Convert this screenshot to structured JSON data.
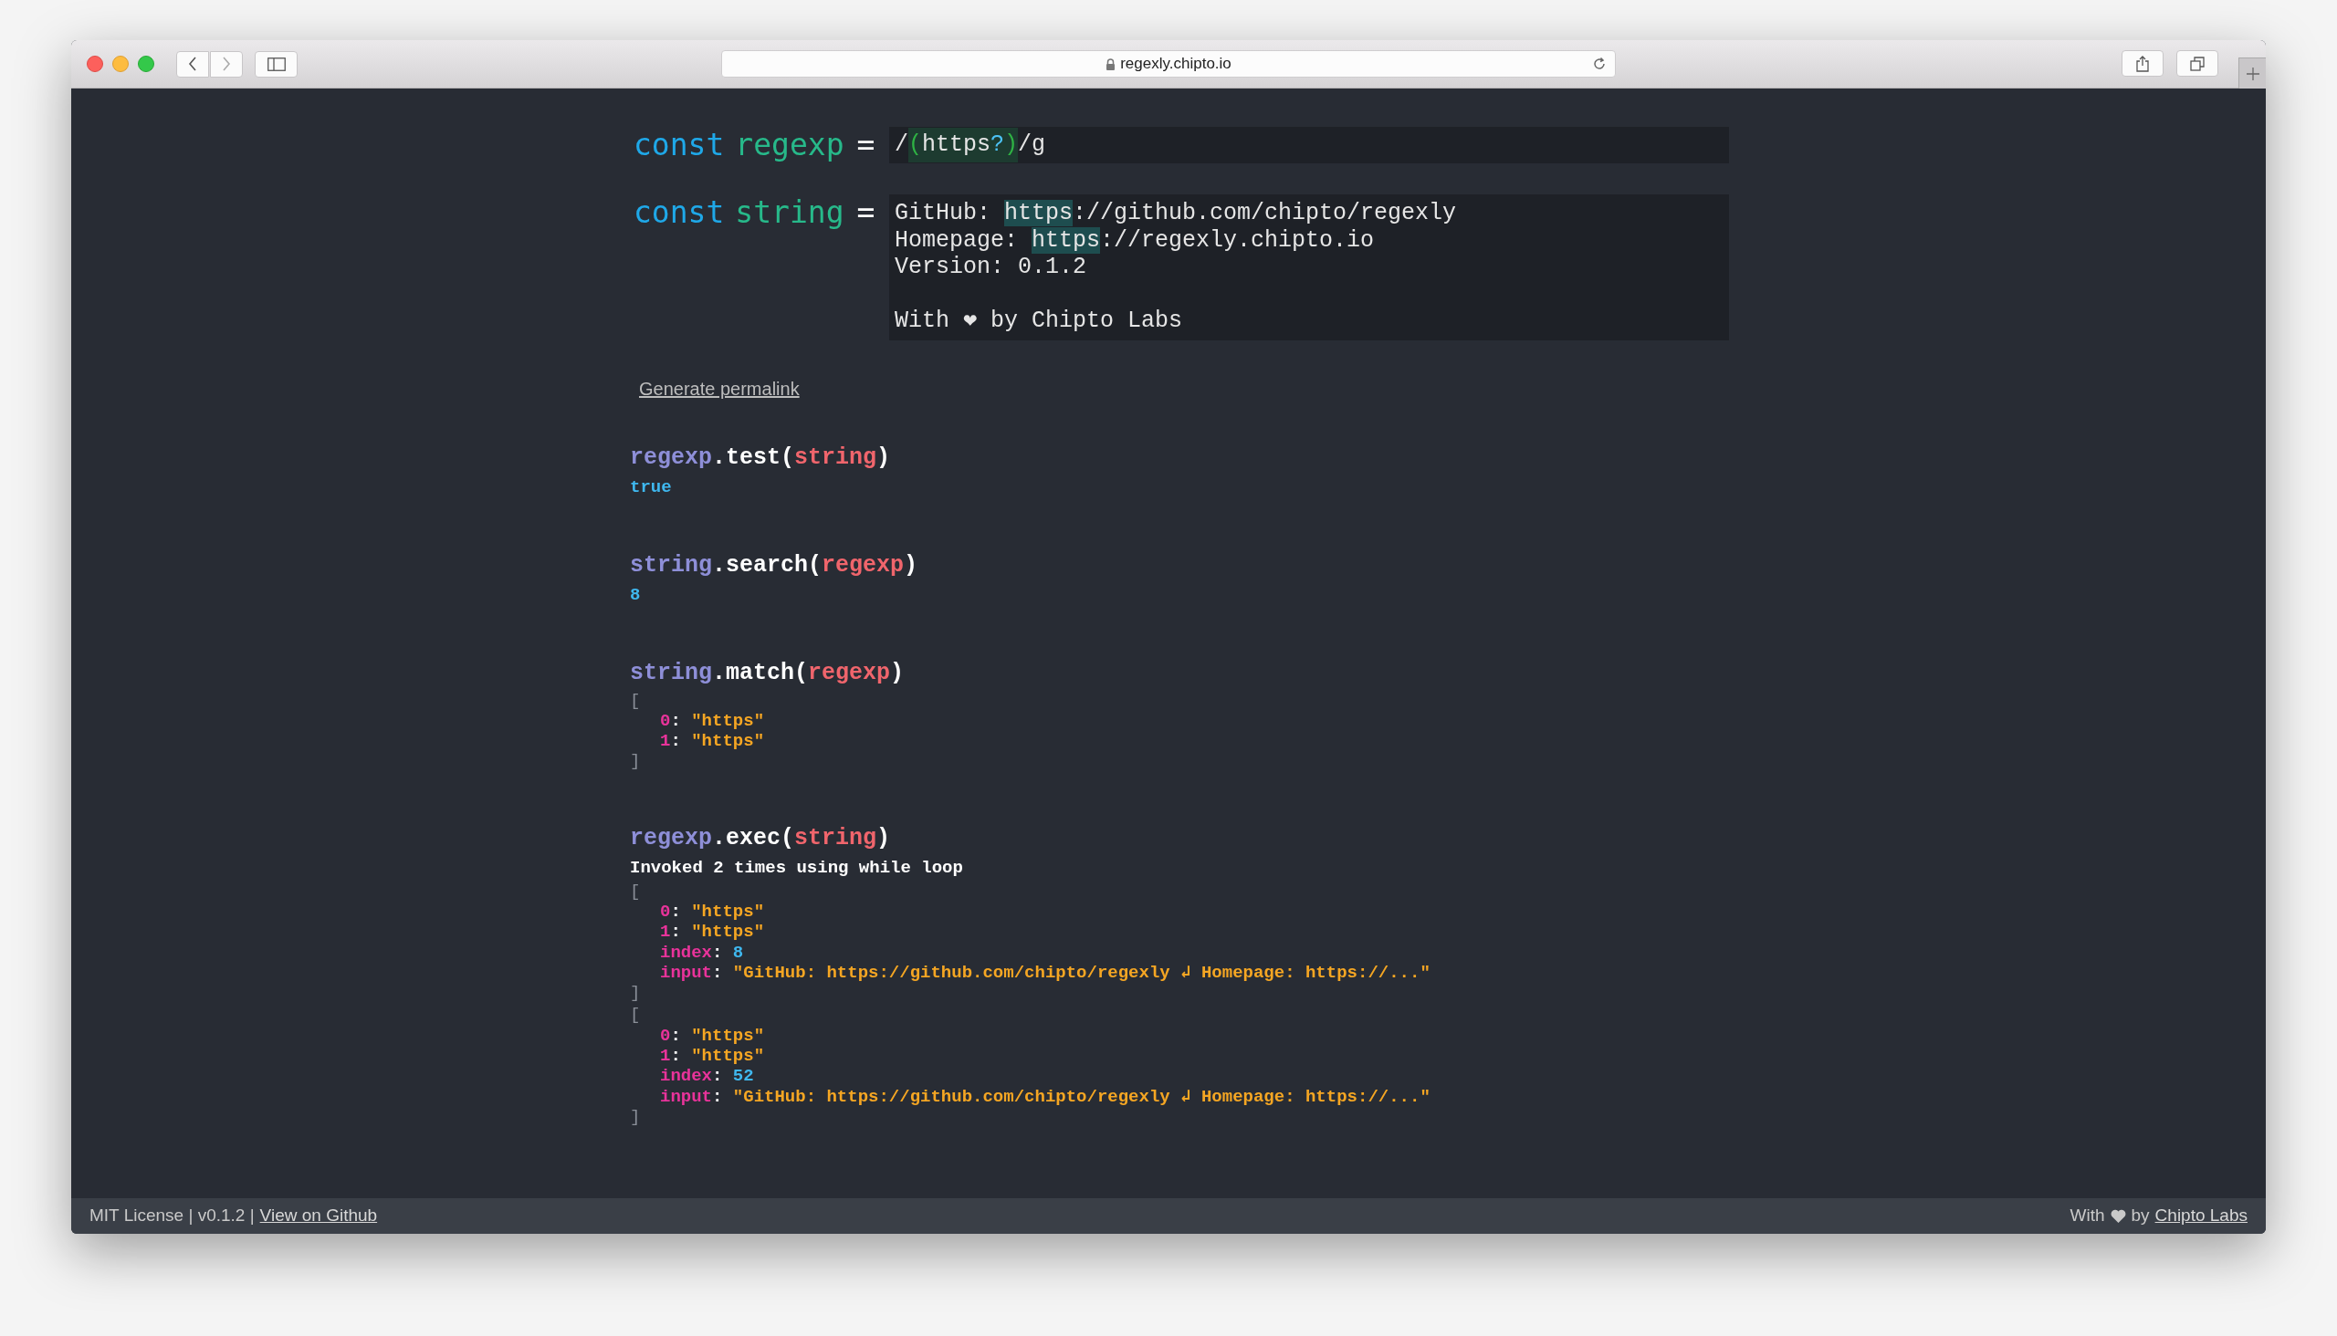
{
  "browser": {
    "url": "regexly.chipto.io"
  },
  "regexp": {
    "keyword": "const",
    "name": "regexp",
    "operator": "=",
    "pattern": [
      {
        "text": "/",
        "kind": "plain"
      },
      {
        "text": "(",
        "kind": "group"
      },
      {
        "text": "https",
        "kind": "literal"
      },
      {
        "text": "?",
        "kind": "quantifier"
      },
      {
        "text": ")",
        "kind": "group"
      },
      {
        "text": "/g",
        "kind": "plain"
      }
    ]
  },
  "string": {
    "keyword": "const",
    "name": "string",
    "operator": "=",
    "lines": [
      {
        "gap_before": false,
        "segments": [
          {
            "text": "GitHub: ",
            "highlighted": false
          },
          {
            "text": "https",
            "highlighted": true
          },
          {
            "text": "://github.com/chipto/regexly",
            "highlighted": false
          }
        ]
      },
      {
        "gap_before": false,
        "segments": [
          {
            "text": "Homepage: ",
            "highlighted": false
          },
          {
            "text": "https",
            "highlighted": true
          },
          {
            "text": "://regexly.chipto.io",
            "highlighted": false
          }
        ]
      },
      {
        "gap_before": false,
        "segments": [
          {
            "text": "Version: 0.1.2",
            "highlighted": false
          }
        ]
      },
      {
        "gap_before": true,
        "segments": [
          {
            "text": "With ❤ by Chipto Labs",
            "highlighted": false
          }
        ]
      }
    ]
  },
  "permalink": "Generate permalink",
  "results": [
    {
      "call": [
        {
          "text": "regexp",
          "kind": "receiver"
        },
        {
          "text": ".test(",
          "kind": "method"
        },
        {
          "text": "string",
          "kind": "argument"
        },
        {
          "text": ")",
          "kind": "method"
        }
      ],
      "output": [
        {
          "kind": "value",
          "text": "true"
        }
      ]
    },
    {
      "call": [
        {
          "text": "string",
          "kind": "receiver"
        },
        {
          "text": ".search(",
          "kind": "method"
        },
        {
          "text": "regexp",
          "kind": "argument"
        },
        {
          "text": ")",
          "kind": "method"
        }
      ],
      "output": [
        {
          "kind": "value",
          "text": "8"
        }
      ]
    },
    {
      "call": [
        {
          "text": "string",
          "kind": "receiver"
        },
        {
          "text": ".match(",
          "kind": "method"
        },
        {
          "text": "regexp",
          "kind": "argument"
        },
        {
          "text": ")",
          "kind": "method"
        }
      ],
      "output": [
        {
          "kind": "array",
          "open": "[",
          "close": "]",
          "entries": [
            {
              "key": "0",
              "colon": ":",
              "value": "\"https\"",
              "kind": "string"
            },
            {
              "key": "1",
              "colon": ":",
              "value": "\"https\"",
              "kind": "string"
            }
          ]
        }
      ]
    },
    {
      "call": [
        {
          "text": "regexp",
          "kind": "receiver"
        },
        {
          "text": ".exec(",
          "kind": "method"
        },
        {
          "text": "string",
          "kind": "argument"
        },
        {
          "text": ")",
          "kind": "method"
        }
      ],
      "output": [
        {
          "kind": "note",
          "text": "Invoked 2 times using while loop"
        },
        {
          "kind": "array",
          "open": "[",
          "close": "]",
          "entries": [
            {
              "key": "0",
              "colon": ":",
              "value": "\"https\"",
              "kind": "string"
            },
            {
              "key": "1",
              "colon": ":",
              "value": "\"https\"",
              "kind": "string"
            },
            {
              "key": "index",
              "colon": ":",
              "value": "8",
              "kind": "number"
            },
            {
              "key": "input",
              "colon": ":",
              "value": "\"GitHub: https://github.com/chipto/regexly ↲ Homepage: https://...\"",
              "kind": "string"
            }
          ]
        },
        {
          "kind": "array",
          "open": "[",
          "close": "]",
          "entries": [
            {
              "key": "0",
              "colon": ":",
              "value": "\"https\"",
              "kind": "string"
            },
            {
              "key": "1",
              "colon": ":",
              "value": "\"https\"",
              "kind": "string"
            },
            {
              "key": "index",
              "colon": ":",
              "value": "52",
              "kind": "number"
            },
            {
              "key": "input",
              "colon": ":",
              "value": "\"GitHub: https://github.com/chipto/regexly ↲ Homepage: https://...\"",
              "kind": "string"
            }
          ]
        }
      ]
    }
  ],
  "footer": {
    "left": [
      {
        "text": "MIT License | v0.1.2 |",
        "kind": "text"
      },
      {
        "text": "View on Github",
        "kind": "link"
      }
    ],
    "right": [
      {
        "text": "With",
        "kind": "text"
      },
      {
        "kind": "heart"
      },
      {
        "text": "by",
        "kind": "text"
      },
      {
        "text": "Chipto Labs",
        "kind": "link"
      }
    ]
  }
}
